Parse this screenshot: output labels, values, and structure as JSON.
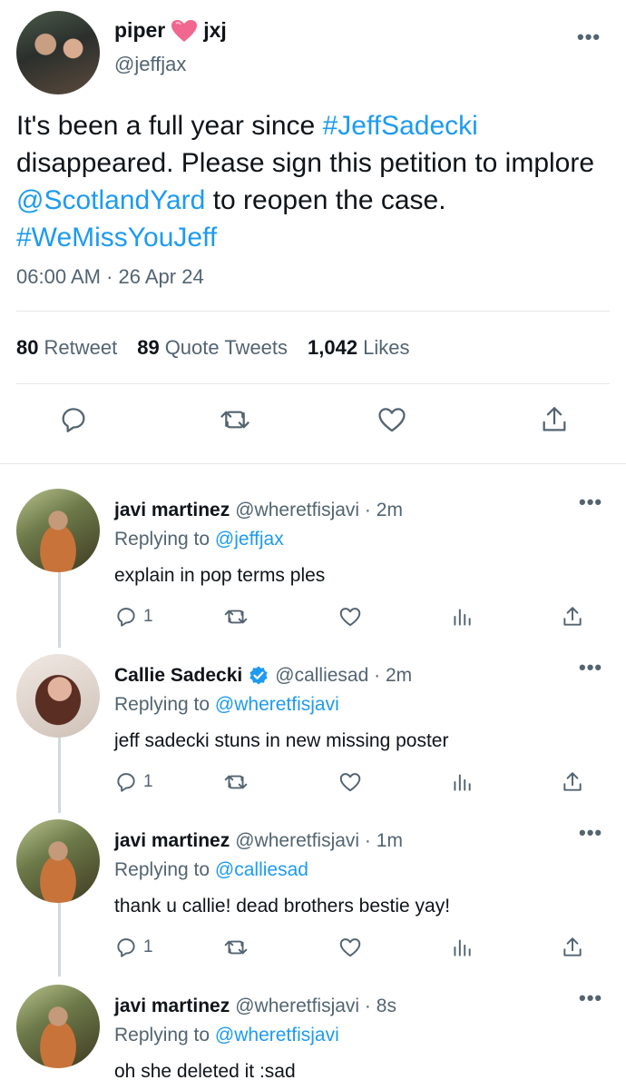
{
  "tweet": {
    "name_left": "piper",
    "name_right": "jxj",
    "handle": "@jeffjax",
    "text_parts": [
      {
        "t": "It's been a full year since ",
        "c": "text"
      },
      {
        "t": "#JeffSadecki",
        "c": "link"
      },
      {
        "t": " disappeared. Please sign this petition to implore ",
        "c": "text"
      },
      {
        "t": "@ScotlandYard",
        "c": "link"
      },
      {
        "t": " to reopen the case. ",
        "c": "text"
      },
      {
        "t": "#WeMissYouJeff",
        "c": "link"
      }
    ],
    "time": "06:00 AM",
    "date": "26 Apr 24",
    "retweets_count": "80",
    "retweets_label": "Retweet",
    "quotes_count": "89",
    "quotes_label": "Quote Tweets",
    "likes_count": "1,042",
    "likes_label": "Likes"
  },
  "replies": [
    {
      "name": "javi martinez",
      "handle": "@wheretfisjavi",
      "time": "2m",
      "replying_prefix": "Replying to",
      "replying_to": "@jeffjax",
      "text": "explain in pop terms ples",
      "reply_count": "1",
      "verified": false
    },
    {
      "name": "Callie Sadecki",
      "handle": "@calliesad",
      "time": "2m",
      "replying_prefix": "Replying to",
      "replying_to": "@wheretfisjavi",
      "text": "jeff sadecki stuns in new missing poster",
      "reply_count": "1",
      "verified": true
    },
    {
      "name": "javi martinez",
      "handle": "@wheretfisjavi",
      "time": "1m",
      "replying_prefix": "Replying to",
      "replying_to": "@calliesad",
      "text": "thank u callie! dead brothers bestie yay!",
      "reply_count": "1",
      "verified": false
    },
    {
      "name": "javi martinez",
      "handle": "@wheretfisjavi",
      "time": "8s",
      "replying_prefix": "Replying to",
      "replying_to": "@wheretfisjavi",
      "text": "oh she deleted it :sad",
      "reply_count": "",
      "verified": false
    }
  ],
  "colors": {
    "link": "#1d9bf0",
    "secondary": "#536471",
    "heart": "#f1678f"
  },
  "icons": [
    "more-icon",
    "reply-icon",
    "retweet-icon",
    "like-icon",
    "share-icon",
    "analytics-icon",
    "verified-icon",
    "heart-emoji-icon"
  ]
}
